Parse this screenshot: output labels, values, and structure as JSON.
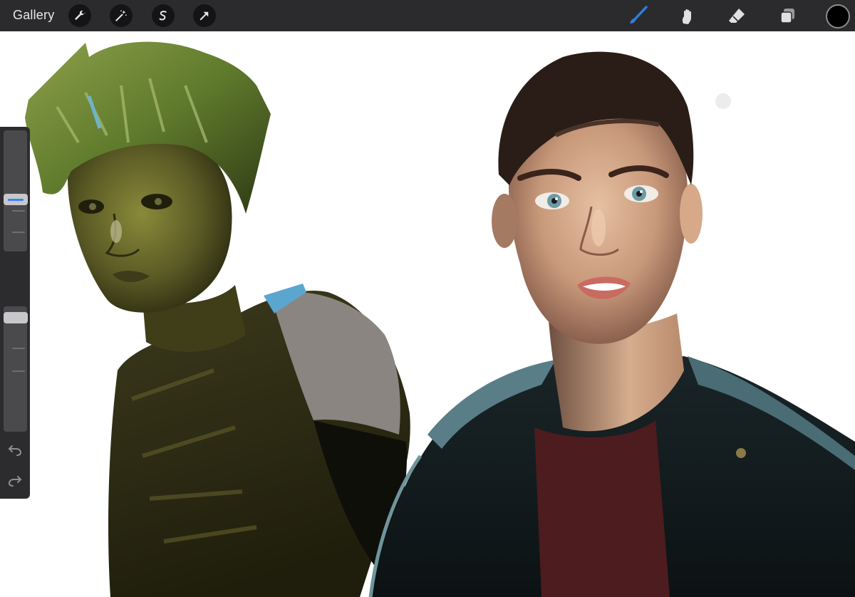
{
  "toolbar": {
    "gallery_label": "Gallery",
    "left_tools": [
      {
        "name": "actions-wrench-icon"
      },
      {
        "name": "adjustments-wand-icon"
      },
      {
        "name": "selection-s-icon"
      },
      {
        "name": "transform-arrow-icon"
      }
    ],
    "right_tools": [
      {
        "name": "brush-icon",
        "active": true,
        "color": "#2f7fe0"
      },
      {
        "name": "smudge-icon",
        "active": false
      },
      {
        "name": "eraser-icon",
        "active": false
      },
      {
        "name": "layers-icon",
        "active": false
      }
    ],
    "current_color": "#000000"
  },
  "sidebar": {
    "brush_size_level": 0.42,
    "opacity_level": 0.95,
    "accent_color": "#3b82f6",
    "icons": [
      "undo-icon",
      "redo-icon",
      "modify-square-icon"
    ]
  }
}
